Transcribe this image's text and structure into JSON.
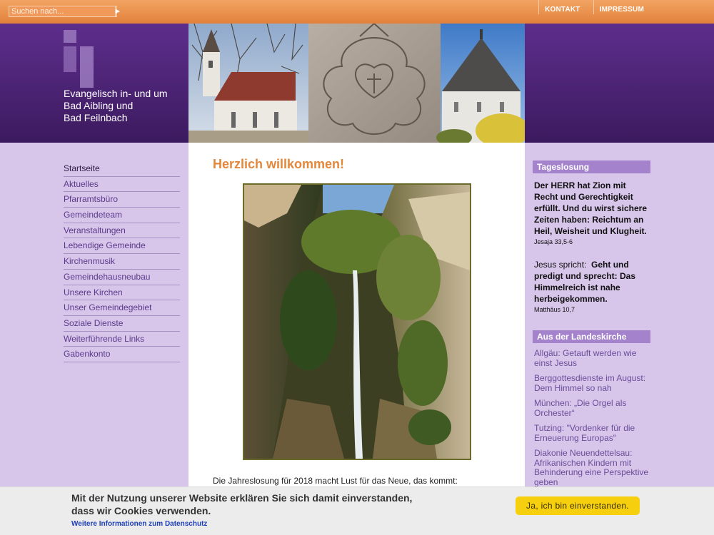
{
  "search": {
    "placeholder": "Suchen nach..."
  },
  "toplinks": {
    "kontakt": "KONTAKT",
    "impressum": "IMPRESSUM"
  },
  "header": {
    "title_lines": [
      "Evangelisch in- und um",
      "Bad Aibling und",
      "Bad Feilnbach"
    ]
  },
  "nav": {
    "items": [
      "Startseite",
      "Aktuelles",
      "Pfarramtsbüro",
      "Gemeindeteam",
      "Veranstaltungen",
      "Lebendige Gemeinde",
      "Kirchenmusik",
      "Gemeindehausneubau",
      "Unsere Kirchen",
      "Unser Gemeindegebiet",
      "Soziale Dienste",
      "Weiterführende Links",
      "Gabenkonto"
    ]
  },
  "main": {
    "heading": "Herzlich willkommen!",
    "jahreslosung": "Die Jahreslosung für 2018 macht Lust für das Neue, das kommt:"
  },
  "tageslosung": {
    "heading": "Tageslosung",
    "verse1": "Der HERR hat Zion mit Recht und Gerechtigkeit erfüllt. Und du wirst sichere Zeiten haben: Reichtum an Heil, Weisheit und Klugheit.",
    "ref1": "Jesaja 33,5-6",
    "verse2_prefix": "Jesus spricht:",
    "verse2": "Geht und predigt und sprecht: Das Himmelreich ist nahe herbeigekommen.",
    "ref2": "Matthäus 10,7"
  },
  "landeskirche": {
    "heading": "Aus der Landeskirche",
    "items": [
      "Allgäu: Getauft werden wie einst Jesus",
      "Berggottesdienste im August: Dem Himmel so nah",
      "München: „Die Orgel als Orchester“",
      "Tutzing: \"Vordenker für die Erneuerung Europas\"",
      "Diakonie Neuendettelsau: Afrikanischen Kindern mit Behinderung eine Perspektive geben"
    ]
  },
  "cookie": {
    "text_line1": "Mit der Nutzung unserer Website erklären Sie sich damit einverstanden,",
    "text_line2": "dass wir Cookies verwenden.",
    "link": "Weitere Informationen zum Datenschutz",
    "button": "Ja, ich bin einverstanden."
  },
  "colors": {
    "orange_bar": "#e8904b",
    "header_purple": "#4e2578",
    "page_lavender": "#d7c5ea",
    "heading_orange": "#e3873a",
    "box_heading": "#a583cc",
    "cookie_button": "#f6d00e"
  }
}
